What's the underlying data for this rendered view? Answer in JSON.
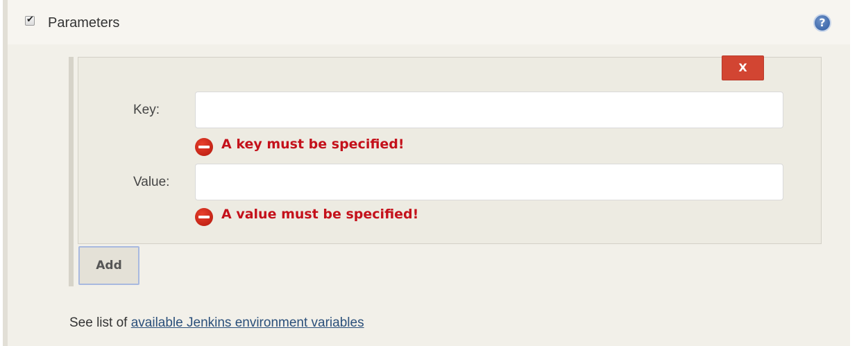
{
  "section": {
    "title": "Parameters",
    "checkbox_glyph": "✔",
    "help_glyph": "?",
    "checked": true
  },
  "param": {
    "delete_label": "X",
    "key_label": "Key:",
    "key_value": "",
    "key_error": "A key must be specified!",
    "value_label": "Value:",
    "value_value": "",
    "value_error": "A value must be specified!"
  },
  "add_label": "Add",
  "footer": {
    "prefix": "See list of ",
    "link_text": "available Jenkins environment variables"
  },
  "icons": {
    "checkbox": "checkbox-checked-icon",
    "help": "help-icon",
    "error": "error-icon"
  },
  "colors": {
    "error_text": "#c4111b",
    "delete_button": "#d24532",
    "link": "#2a4f7a",
    "panel_bg": "#f2f0e9"
  }
}
